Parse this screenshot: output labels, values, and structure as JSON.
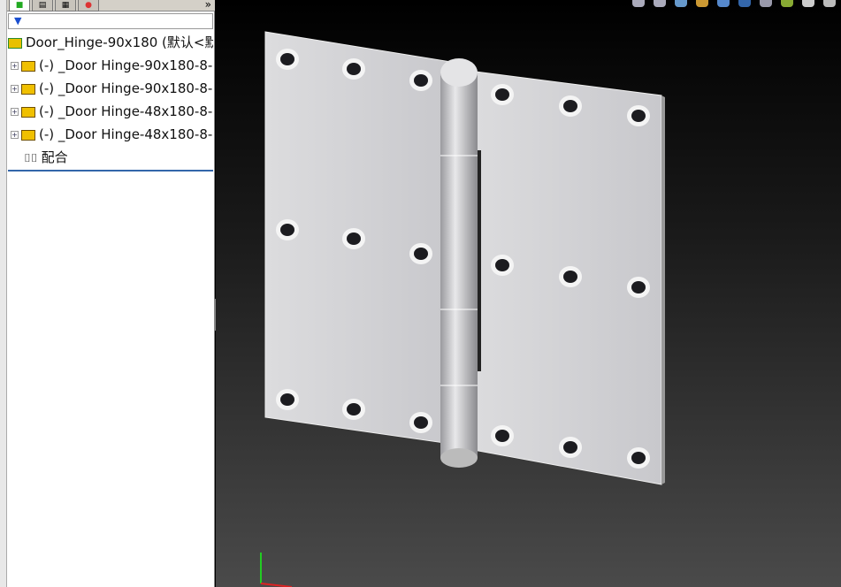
{
  "panel": {
    "tabs": [
      "feature-manager",
      "property-manager",
      "configuration-manager",
      "display-manager"
    ],
    "more": "»",
    "filter": "▼",
    "root": "Door_Hinge-90x180  (默认<默",
    "items": [
      {
        "label": "(-) _Door Hinge-90x180-8-"
      },
      {
        "label": "(-) _Door Hinge-90x180-8-"
      },
      {
        "label": "(-) _Door Hinge-48x180-8-"
      },
      {
        "label": "(-) _Door Hinge-48x180-8-"
      }
    ],
    "mates": "配合",
    "expand": "+",
    "collapse": "‹"
  },
  "toolbar": [
    "zoom-to-fit",
    "zoom-area",
    "previous-view",
    "section-view",
    "view-orientation",
    "display-style",
    "hide-show",
    "edit-appearance",
    "apply-scene",
    "view-settings"
  ]
}
